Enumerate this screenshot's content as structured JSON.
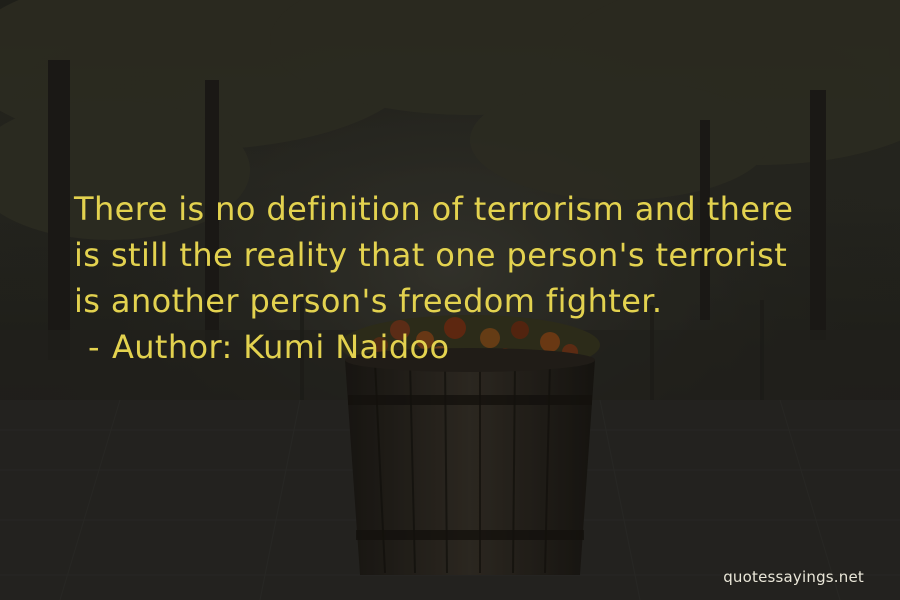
{
  "quote": {
    "lines": [
      "There is no definition of terrorism and there",
      "is still the reality that one person's terrorist",
      "is another person's freedom fighter."
    ],
    "dash": "-",
    "author_prefix": "Author:",
    "author_name": "Kumi Naidoo"
  },
  "watermark": "quotessayings.net",
  "colors": {
    "quote_text": "#e3d24f",
    "watermark_text": "#e9e6d8",
    "background": "#2a2a22"
  }
}
